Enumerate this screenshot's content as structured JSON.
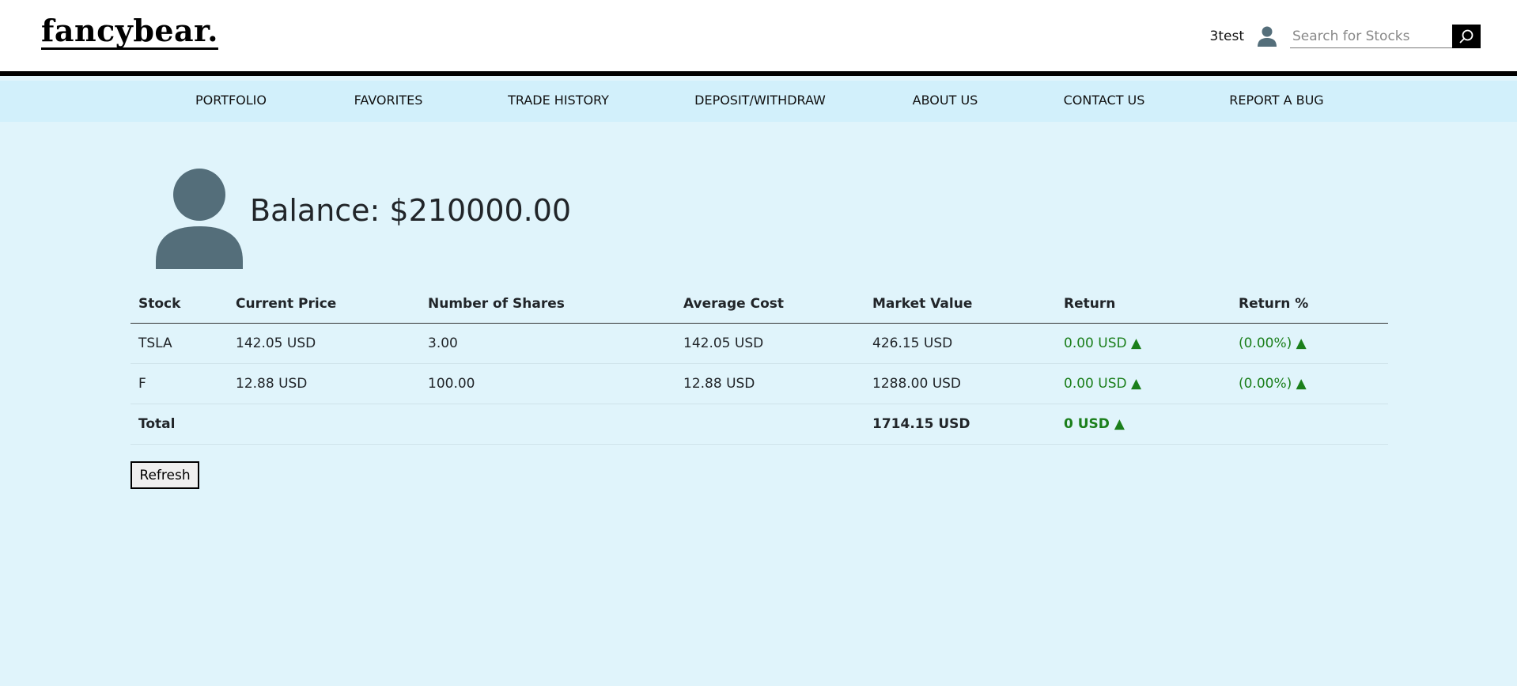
{
  "header": {
    "logo": "fancybear.",
    "username": "3test",
    "search_placeholder": "Search for Stocks"
  },
  "nav": {
    "items": [
      {
        "label": "PORTFOLIO"
      },
      {
        "label": "FAVORITES"
      },
      {
        "label": "TRADE HISTORY"
      },
      {
        "label": "DEPOSIT/WITHDRAW"
      },
      {
        "label": "ABOUT US"
      },
      {
        "label": "CONTACT US"
      },
      {
        "label": "REPORT A BUG"
      }
    ]
  },
  "account": {
    "balance_label": "Balance: $210000.00"
  },
  "table": {
    "headers": [
      "Stock",
      "Current Price",
      "Number of Shares",
      "Average Cost",
      "Market Value",
      "Return",
      "Return %"
    ],
    "rows": [
      {
        "stock": "TSLA",
        "price": "142.05 USD",
        "shares": "3.00",
        "avg_cost": "142.05 USD",
        "market_value": "426.15 USD",
        "return": "0.00 USD ▲",
        "return_pct": "(0.00%) ▲"
      },
      {
        "stock": "F",
        "price": "12.88 USD",
        "shares": "100.00",
        "avg_cost": "12.88 USD",
        "market_value": "1288.00 USD",
        "return": "0.00 USD ▲",
        "return_pct": "(0.00%) ▲"
      }
    ],
    "total": {
      "label": "Total",
      "market_value": "1714.15 USD",
      "return": "0 USD ▲"
    }
  },
  "actions": {
    "refresh_label": "Refresh"
  },
  "colors": {
    "page_background": "#e0f4fb",
    "nav_background": "#d2f0fb",
    "positive_green": "#1b7f1b",
    "avatar": "#546e7a"
  },
  "icons": {
    "user": "user-icon",
    "search": "search-icon",
    "avatar": "avatar-icon"
  }
}
